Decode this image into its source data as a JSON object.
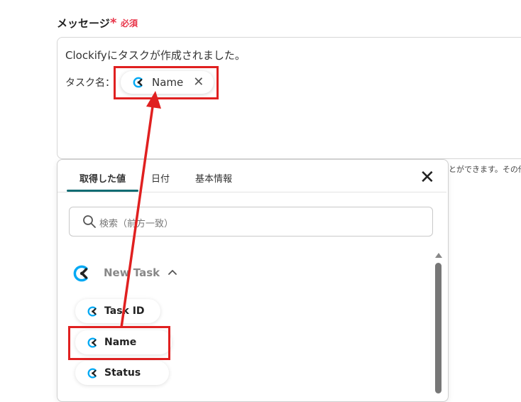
{
  "message_field": {
    "label": "メッセージ",
    "required_star": "*",
    "required_text": "必須",
    "body_line1": "Clockifyにタスクが作成されました。",
    "body_line2_label": "タスク名：",
    "inserted_chip_label": "Name",
    "remove_glyph": "✕"
  },
  "helper_text": "とができます。その他",
  "picker": {
    "tabs": [
      "取得した値",
      "日付",
      "基本情報"
    ],
    "active_tab": "取得した値",
    "close_glyph": "✕",
    "search_placeholder": "検索（前方一致）",
    "group_title": "New Task",
    "items": [
      {
        "label": "Task ID"
      },
      {
        "label": "Name"
      },
      {
        "label": "Status"
      }
    ]
  },
  "colors": {
    "accent": "#126c73",
    "required": "#e8364a",
    "highlight_box": "#e02020",
    "clockify_blue": "#03a9f4",
    "clockify_dark": "#222222"
  }
}
